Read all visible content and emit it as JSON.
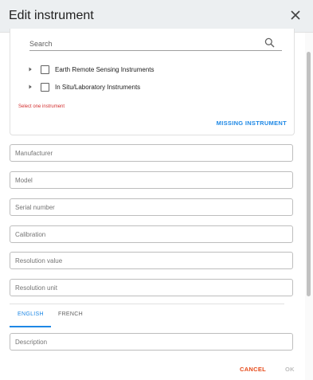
{
  "dialog": {
    "title": "Edit instrument",
    "close_icon": "close-icon"
  },
  "instrument_picker": {
    "search_placeholder": "Search",
    "search_icon": "search-icon",
    "tree": [
      {
        "label": "Earth Remote Sensing Instruments",
        "expanded": false,
        "checked": false
      },
      {
        "label": "In Situ/Laboratory Instruments",
        "expanded": false,
        "checked": false
      }
    ],
    "error": "Select one instrument",
    "missing_button": "MISSING INSTRUMENT"
  },
  "fields": {
    "manufacturer": "Manufacturer",
    "model": "Model",
    "serial_number": "Serial number",
    "calibration": "Calibration",
    "resolution_value": "Resolution value",
    "resolution_unit": "Resolution unit",
    "description": "Description"
  },
  "tabs": [
    {
      "label": "ENGLISH",
      "active": true
    },
    {
      "label": "FRENCH",
      "active": false
    }
  ],
  "actions": {
    "cancel": "CANCEL",
    "ok": "OK"
  },
  "colors": {
    "accent": "#1e88e5",
    "error": "#d32f2f",
    "cancel": "#e64a19",
    "disabled": "#bdbdbd",
    "header_bg": "#eceff1"
  }
}
